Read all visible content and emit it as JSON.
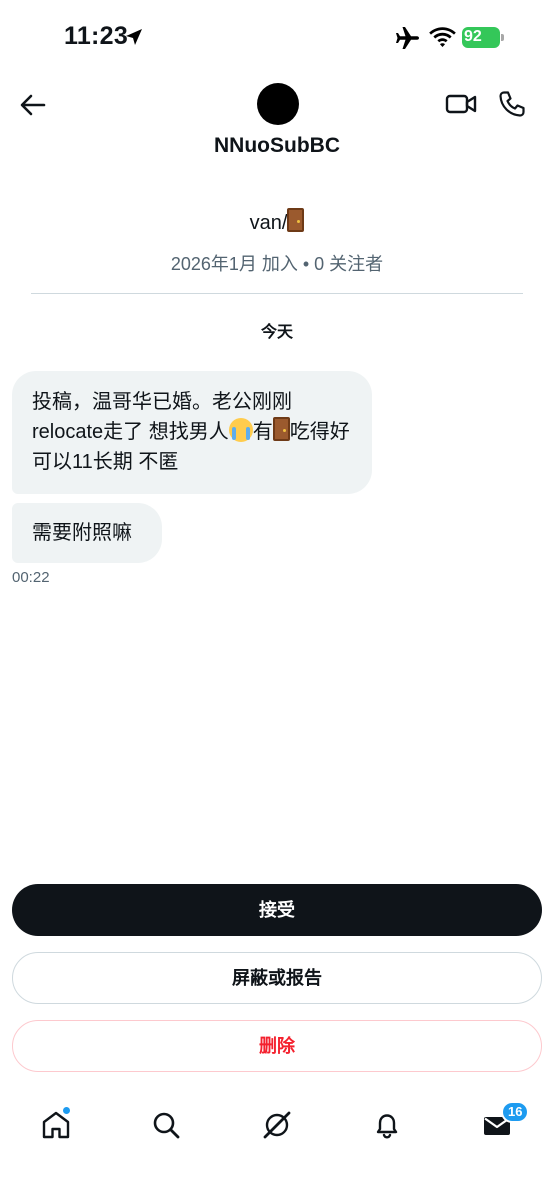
{
  "status_bar": {
    "time": "11:23",
    "battery": "92"
  },
  "header": {
    "username": "NNuoSubBC"
  },
  "profile": {
    "bio_text": "van/",
    "meta": "2026年1月 加入 • 0 关注者"
  },
  "conversation": {
    "date_separator": "今天",
    "messages": [
      {
        "text_part1": "投稿，温哥华已婚。老公刚刚relocate走了 想找男人",
        "text_part2": "有",
        "text_part3": "吃得好可以11长期 不匿"
      },
      {
        "text": "需要附照嘛"
      }
    ],
    "timestamp": "00:22"
  },
  "actions": {
    "accept_label": "接受",
    "block_label": "屏蔽或报告",
    "delete_label": "删除"
  },
  "tab_bar": {
    "messages_badge": "16"
  },
  "colors": {
    "accent": "#1d9bf0",
    "primary_button": "#0f1419",
    "danger": "#f4212e",
    "bubble_bg": "#eff3f4",
    "secondary_text": "#536471"
  }
}
